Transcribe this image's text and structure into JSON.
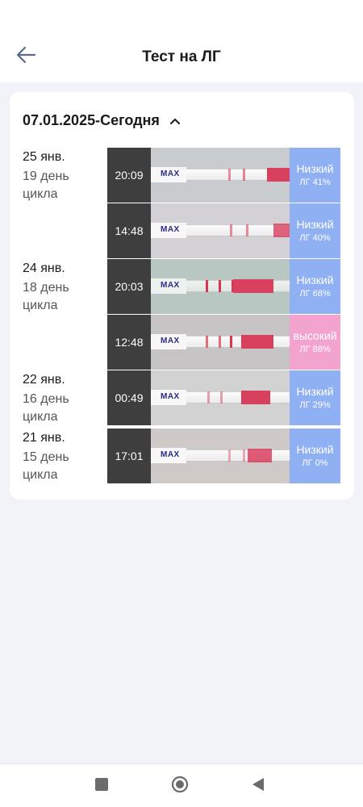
{
  "header": {
    "title": "Тест на ЛГ"
  },
  "range": {
    "label": "07.01.2025-Сегодня"
  },
  "days": [
    {
      "date": "25 янв.",
      "cycle": "19 день цикла"
    },
    {
      "date": "24 янв.",
      "cycle": "18 день цикла"
    },
    {
      "date": "22 янв.",
      "cycle": "16 день цикла"
    },
    {
      "date": "21 янв.",
      "cycle": "15 день цикла"
    }
  ],
  "entries": [
    {
      "time": "20:09",
      "level": "Низкий",
      "pct": "ЛГ 41%",
      "strip_text": "MAX",
      "color": "#8fb0f2"
    },
    {
      "time": "14:48",
      "level": "Низкий",
      "pct": "ЛГ 40%",
      "strip_text": "MAX",
      "color": "#8fb0f2"
    },
    {
      "time": "20:03",
      "level": "Низкий",
      "pct": "ЛГ 68%",
      "strip_text": "MAX",
      "color": "#8fb0f2"
    },
    {
      "time": "12:48",
      "level": "высокий",
      "pct": "ЛГ 88%",
      "strip_text": "MAX",
      "color": "#f2a4cf"
    },
    {
      "time": "00:49",
      "level": "Низкий",
      "pct": "ЛГ 29%",
      "strip_text": "MAX",
      "color": "#8fb0f2"
    },
    {
      "time": "17:01",
      "level": "Низкий",
      "pct": "ЛГ 0%",
      "strip_text": "MAX",
      "color": "#8fb0f2"
    }
  ],
  "icons": {
    "back": "arrow-left-icon",
    "chevron": "chevron-up-icon",
    "nav": [
      "square-recents-icon",
      "circle-home-icon",
      "triangle-back-icon"
    ]
  },
  "colors": {
    "low": "#8fb0f2",
    "high": "#f2a4cf",
    "background": "#f2f3f8"
  }
}
